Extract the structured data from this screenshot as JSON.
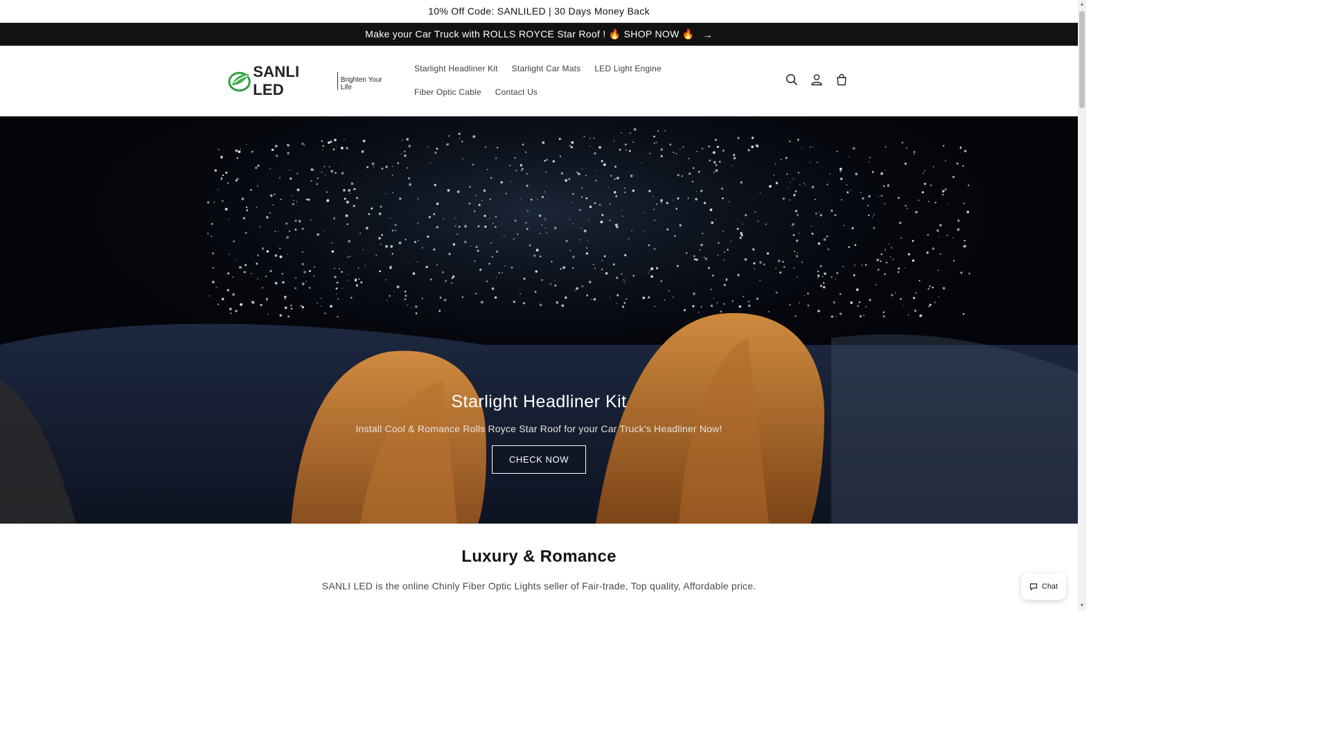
{
  "announcements": {
    "top": "10% Off Code: SANLILED | 30 Days Money Back",
    "promo_text": "Make your Car Truck with ROLLS ROYCE Star Roof ! 🔥 SHOP NOW 🔥",
    "promo_arrow": "→"
  },
  "header": {
    "logo": {
      "brand": "SANLI LED",
      "tagline": "Brighten Your Life",
      "mark_color": "#2e9e3e"
    },
    "nav": [
      {
        "label": "Starlight Headliner Kit"
      },
      {
        "label": "Starlight Car Mats"
      },
      {
        "label": "LED Light Engine"
      },
      {
        "label": "Fiber Optic Cable"
      },
      {
        "label": "Contact Us"
      }
    ],
    "icons": [
      "search-icon",
      "account-icon",
      "cart-icon"
    ]
  },
  "hero": {
    "title": "Starlight Headliner Kit",
    "subtitle": "Install Cool & Romance Rolls Royce Star Roof for your Car Truck's Headliner Now!",
    "button": "CHECK NOW",
    "seat_color": "#c27a35"
  },
  "intro": {
    "title": "Luxury & Romance",
    "text": "SANLI LED is the online Chinly Fiber Optic Lights seller of Fair-trade, Top quality, Affordable price."
  },
  "chat": {
    "label": "Chat"
  }
}
